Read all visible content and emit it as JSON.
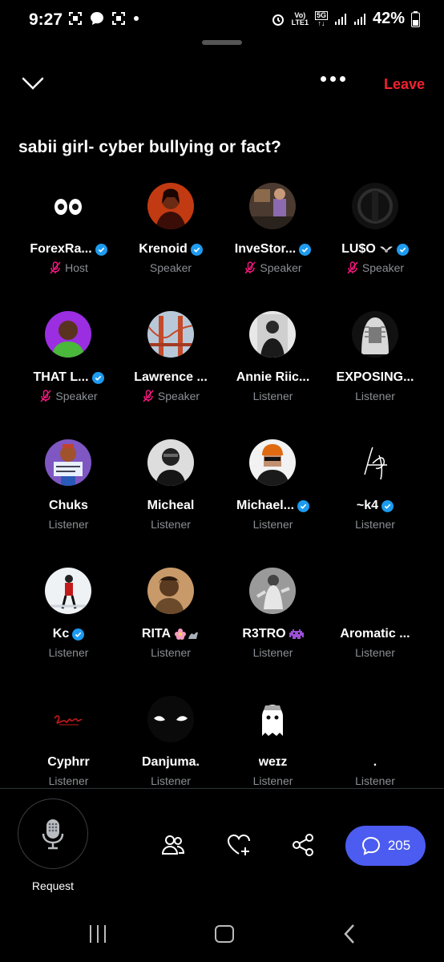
{
  "status_bar": {
    "time": "9:27",
    "net_top": "Vo)",
    "net_bottom": "LTE1",
    "gen": "5G",
    "battery": "42%"
  },
  "header": {
    "leave_label": "Leave"
  },
  "space": {
    "title": "sabii girl- cyber bullying or fact?"
  },
  "participants": [
    {
      "name": "ForexRa...",
      "role": "Host",
      "verified": true,
      "muted": true,
      "avatar": "eyes-emoji",
      "badge": ""
    },
    {
      "name": "Krenoid",
      "role": "Speaker",
      "verified": true,
      "muted": false,
      "avatar": "woman-red-portrait",
      "badge": ""
    },
    {
      "name": "InveStor...",
      "role": "Speaker",
      "verified": true,
      "muted": true,
      "avatar": "room-photo",
      "badge": ""
    },
    {
      "name": "LU$O",
      "role": "Speaker",
      "verified": true,
      "muted": true,
      "avatar": "dark-logo",
      "badge": "bird-wings"
    },
    {
      "name": "THAT L...",
      "role": "Speaker",
      "verified": true,
      "muted": true,
      "avatar": "man-purple-bg",
      "badge": ""
    },
    {
      "name": "Lawrence ...",
      "role": "Speaker",
      "verified": false,
      "muted": true,
      "avatar": "bridge-photo",
      "badge": ""
    },
    {
      "name": "Annie Riic...",
      "role": "Listener",
      "verified": false,
      "muted": false,
      "avatar": "mirror-selfie",
      "badge": ""
    },
    {
      "name": "EXPOSING...",
      "role": "Listener",
      "verified": false,
      "muted": false,
      "avatar": "judge-wig",
      "badge": ""
    },
    {
      "name": "Chuks",
      "role": "Listener",
      "verified": false,
      "muted": false,
      "avatar": "cartoon-sign",
      "badge": ""
    },
    {
      "name": "Micheal",
      "role": "Listener",
      "verified": false,
      "muted": false,
      "avatar": "bw-portrait",
      "badge": ""
    },
    {
      "name": "Michael...",
      "role": "Listener",
      "verified": true,
      "muted": false,
      "avatar": "orange-beanie",
      "badge": ""
    },
    {
      "name": "~k4",
      "role": "Listener",
      "verified": true,
      "muted": false,
      "avatar": "signature",
      "badge": ""
    },
    {
      "name": "Kc",
      "role": "Listener",
      "verified": true,
      "muted": false,
      "avatar": "snow-photo",
      "badge": ""
    },
    {
      "name": "RITA",
      "role": "Listener",
      "verified": false,
      "muted": false,
      "avatar": "selfie-warm",
      "badge": "flower-muscle"
    },
    {
      "name": "R3TRO",
      "role": "Listener",
      "verified": false,
      "muted": false,
      "avatar": "grey-figure",
      "badge": "space-invader"
    },
    {
      "name": "Aromatic ...",
      "role": "Listener",
      "verified": false,
      "muted": false,
      "avatar": "none",
      "badge": ""
    },
    {
      "name": "Cyphrr",
      "role": "Listener",
      "verified": false,
      "muted": false,
      "avatar": "red-script",
      "badge": ""
    },
    {
      "name": "Danjuma.",
      "role": "Listener",
      "verified": false,
      "muted": false,
      "avatar": "glowing-eyes",
      "badge": ""
    },
    {
      "name": "weɪz",
      "role": "Listener",
      "verified": false,
      "muted": false,
      "avatar": "ghost",
      "badge": ""
    },
    {
      "name": ".",
      "role": "Listener",
      "verified": false,
      "muted": false,
      "avatar": "none",
      "badge": ""
    }
  ],
  "bottom_bar": {
    "request_label": "Request",
    "comment_count": "205",
    "actions": [
      "people-icon",
      "heart-plus-icon",
      "share-icon"
    ]
  },
  "colors": {
    "leave": "#f4212e",
    "verified": "#1d9bf0",
    "comments_bg": "#4c5cf0",
    "role_text": "#8b8f94",
    "muted": "#f91880"
  }
}
